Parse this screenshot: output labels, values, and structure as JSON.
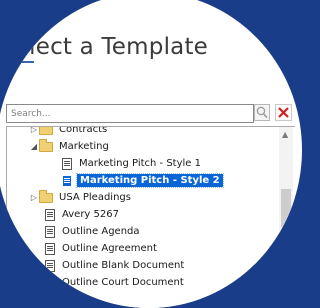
{
  "dialog": {
    "title": "Select a Template"
  },
  "search": {
    "placeholder": "Search...",
    "value": ""
  },
  "icons": {
    "search": "magnifier-icon",
    "clear": "red-x-icon",
    "folder": "folder-icon",
    "document": "document-icon"
  },
  "colors": {
    "selection": "#0a66d6",
    "folder": "#f1cf73",
    "clear": "#d32020",
    "backdrop": "#1a3d8a"
  },
  "tree": {
    "items": [
      {
        "label": "Contracts",
        "type": "folder",
        "expander": "▷"
      },
      {
        "label": "Marketing",
        "type": "folder",
        "expander": "◢"
      },
      {
        "label": "Marketing Pitch - Style 1",
        "type": "document"
      },
      {
        "label": "Marketing Pitch - Style 2",
        "type": "document",
        "selected": true
      },
      {
        "label": "USA Pleadings",
        "type": "folder",
        "expander": "▷"
      },
      {
        "label": "Avery 5267",
        "type": "document"
      },
      {
        "label": "Outline Agenda",
        "type": "document"
      },
      {
        "label": "Outline Agreement",
        "type": "document"
      },
      {
        "label": "Outline Blank Document",
        "type": "document"
      },
      {
        "label": "Outline Court Document",
        "type": "document"
      }
    ]
  }
}
